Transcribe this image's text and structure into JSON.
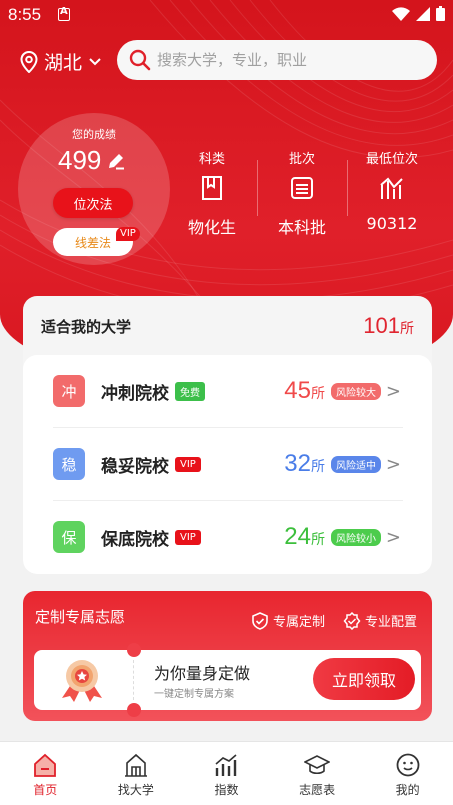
{
  "status_bar": {
    "time": "8:55"
  },
  "header": {
    "location": "湖北",
    "search_placeholder": "搜索大学，专业，职业"
  },
  "score": {
    "label": "您的成绩",
    "value": "499",
    "rank_button": "位次法",
    "line_button": "线差法",
    "vip_tag": "VIP"
  },
  "stats": [
    {
      "label": "科类",
      "value": "物化生"
    },
    {
      "label": "批次",
      "value": "本科批"
    },
    {
      "label": "最低位次",
      "value": "90312"
    }
  ],
  "suitable": {
    "title": "适合我的大学",
    "count": "101",
    "unit": "所",
    "rows": [
      {
        "icon_char": "冲",
        "name": "冲刺院校",
        "tag": "免费",
        "count": "45",
        "unit": "所",
        "risk": "风险较大",
        "color": "#f04a4a",
        "tag_color": "#3cbf4a",
        "icon_color": "#f26b6b"
      },
      {
        "icon_char": "稳",
        "name": "稳妥院校",
        "tag": "VIP",
        "count": "32",
        "unit": "所",
        "risk": "风险适中",
        "color": "#4a7de8",
        "tag_color": "#e8121a",
        "icon_color": "#6f9bf0"
      },
      {
        "icon_char": "保",
        "name": "保底院校",
        "tag": "VIP",
        "count": "24",
        "unit": "所",
        "risk": "风险较小",
        "color": "#3cbf3c",
        "tag_color": "#e8121a",
        "icon_color": "#5fd35f"
      }
    ]
  },
  "banner": {
    "title": "定制专属志愿",
    "feature1": "专属定制",
    "feature2": "专业配置",
    "ticket_title": "为你量身定做",
    "ticket_sub": "一键定制专属方案",
    "cta": "立即领取"
  },
  "tabbar": [
    {
      "label": "首页",
      "icon": "home-icon",
      "active": true
    },
    {
      "label": "找大学",
      "icon": "university-icon",
      "active": false
    },
    {
      "label": "指数",
      "icon": "chart-icon",
      "active": false
    },
    {
      "label": "志愿表",
      "icon": "graduation-cap-icon",
      "active": false
    },
    {
      "label": "我的",
      "icon": "profile-icon",
      "active": false
    }
  ],
  "colors": {
    "primary": "#e0202a"
  }
}
